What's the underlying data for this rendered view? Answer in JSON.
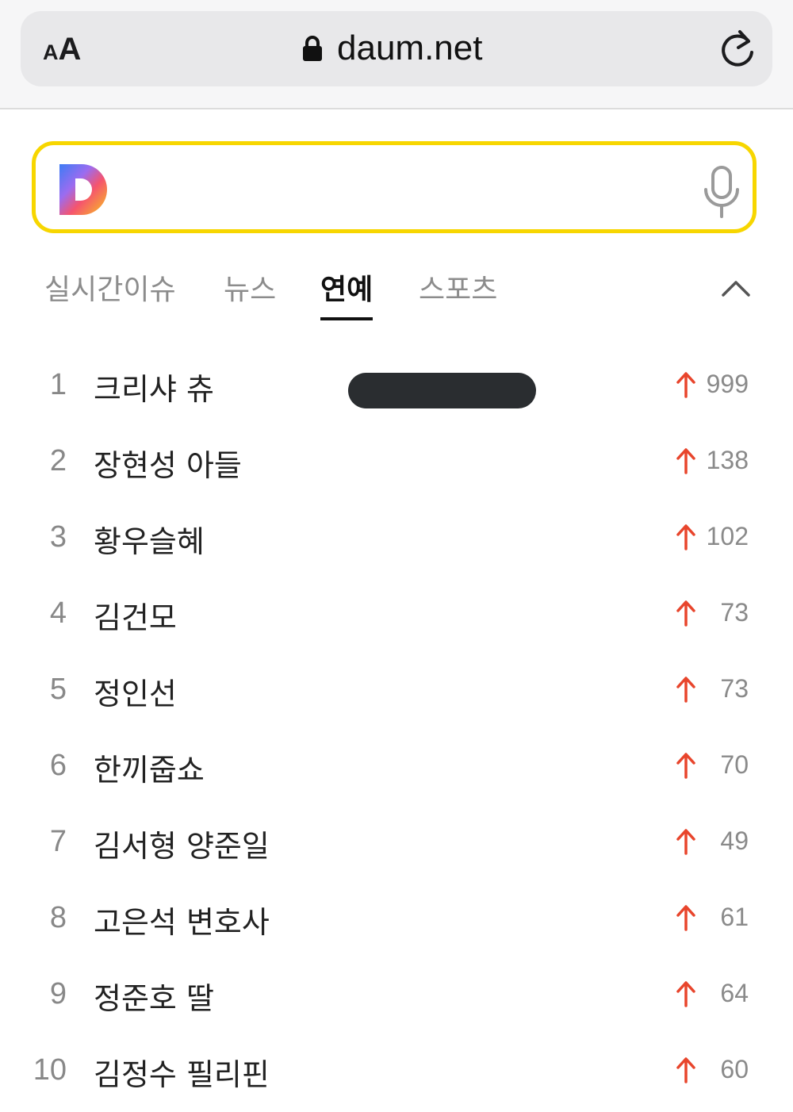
{
  "browser": {
    "text_size_small": "A",
    "text_size_big": "A",
    "url": "daum.net",
    "lock_icon": "lock-icon",
    "reload_icon": "reload-icon"
  },
  "search": {
    "logo": "daum-logo",
    "mic_icon": "microphone-icon",
    "border_color": "#f7d600"
  },
  "tabs": [
    {
      "label": "실시간이슈",
      "active": false
    },
    {
      "label": "뉴스",
      "active": false
    },
    {
      "label": "연예",
      "active": true
    },
    {
      "label": "스포츠",
      "active": false
    }
  ],
  "collapse_icon": "chevron-up-icon",
  "trending": [
    {
      "rank": "1",
      "keyword": "크리샤 츄",
      "count": "999"
    },
    {
      "rank": "2",
      "keyword": "장현성 아들",
      "count": "138"
    },
    {
      "rank": "3",
      "keyword": "황우슬혜",
      "count": "102"
    },
    {
      "rank": "4",
      "keyword": "김건모",
      "count": "73"
    },
    {
      "rank": "5",
      "keyword": "정인선",
      "count": "73"
    },
    {
      "rank": "6",
      "keyword": "한끼줍쇼",
      "count": "70"
    },
    {
      "rank": "7",
      "keyword": "김서형 양준일",
      "count": "49"
    },
    {
      "rank": "8",
      "keyword": "고은석 변호사",
      "count": "61"
    },
    {
      "rank": "9",
      "keyword": "정준호 딸",
      "count": "64"
    },
    {
      "rank": "10",
      "keyword": "김정수 필리핀",
      "count": "60"
    }
  ],
  "trend_color": "#e8452c"
}
